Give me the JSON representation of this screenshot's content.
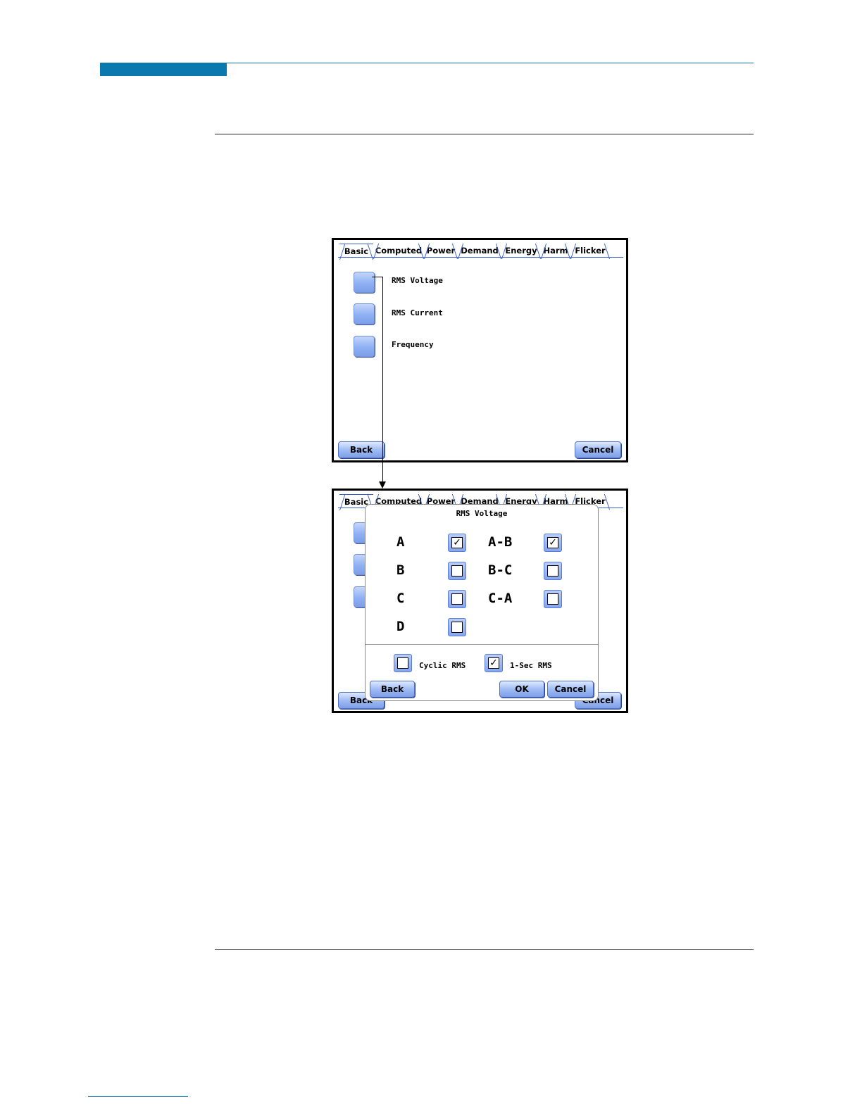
{
  "screen1": {
    "tabs": [
      "Basic",
      "Computed",
      "Power",
      "Demand",
      "Energy",
      "Harm",
      "Flicker"
    ],
    "items": [
      "RMS Voltage",
      "RMS Current",
      "Frequency"
    ],
    "back_label": "Back",
    "cancel_label": "Cancel"
  },
  "screen2": {
    "tabs": [
      "Basic",
      "Computed",
      "Power",
      "Demand",
      "Energy",
      "Harm",
      "Flicker"
    ],
    "back_label": "Back",
    "cancel_label": "Cancel",
    "dialog": {
      "title": "RMS Voltage",
      "phases": [
        {
          "label": "A",
          "checked": true
        },
        {
          "label": "B",
          "checked": false
        },
        {
          "label": "C",
          "checked": false
        },
        {
          "label": "D",
          "checked": false
        }
      ],
      "line_pairs": [
        {
          "label": "A-B",
          "checked": true
        },
        {
          "label": "B-C",
          "checked": false
        },
        {
          "label": "C-A",
          "checked": false
        }
      ],
      "options": [
        {
          "label": "Cyclic RMS",
          "checked": false
        },
        {
          "label": "1-Sec RMS",
          "checked": true
        }
      ],
      "back_label": "Back",
      "ok_label": "OK",
      "cancel_label": "Cancel"
    }
  }
}
